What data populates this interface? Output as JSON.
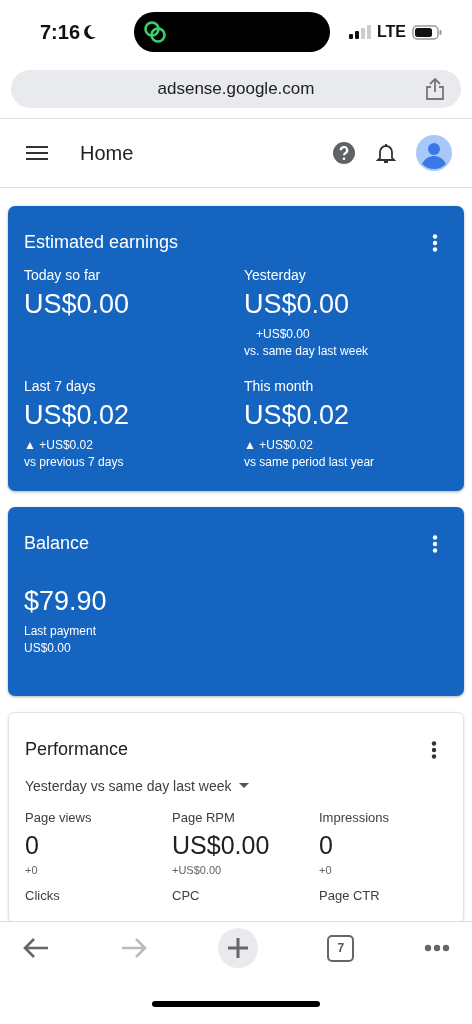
{
  "status_bar": {
    "time": "7:16",
    "network": "LTE"
  },
  "browser": {
    "url": "adsense.google.com",
    "tab_count": "7",
    "back_disabled": false,
    "forward_disabled": true
  },
  "header": {
    "title": "Home"
  },
  "earnings": {
    "title": "Estimated earnings",
    "items": [
      {
        "label": "Today so far",
        "value": "US$0.00"
      },
      {
        "label": "Yesterday",
        "value": "US$0.00",
        "delta": "+US$0.00",
        "kind": "flat",
        "compare": "vs. same day last week"
      },
      {
        "label": "Last 7 days",
        "value": "US$0.02",
        "delta": "▲ +US$0.02",
        "kind": "up",
        "compare": "vs previous 7 days"
      },
      {
        "label": "This month",
        "value": "US$0.02",
        "delta": "▲ +US$0.02",
        "kind": "up",
        "compare": "vs same period last year"
      }
    ]
  },
  "balance": {
    "title": "Balance",
    "amount": "$79.90",
    "last_payment_label": "Last payment",
    "last_payment": "US$0.00"
  },
  "performance": {
    "title": "Performance",
    "range": "Yesterday vs same day last week",
    "metrics": [
      {
        "label": "Page views",
        "value": "0",
        "change": "+0"
      },
      {
        "label": "Page RPM",
        "value": "US$0.00",
        "change": "+US$0.00"
      },
      {
        "label": "Impressions",
        "value": "0",
        "change": "+0"
      },
      {
        "label": "Clicks"
      },
      {
        "label": "CPC"
      },
      {
        "label": "Page CTR"
      }
    ]
  }
}
